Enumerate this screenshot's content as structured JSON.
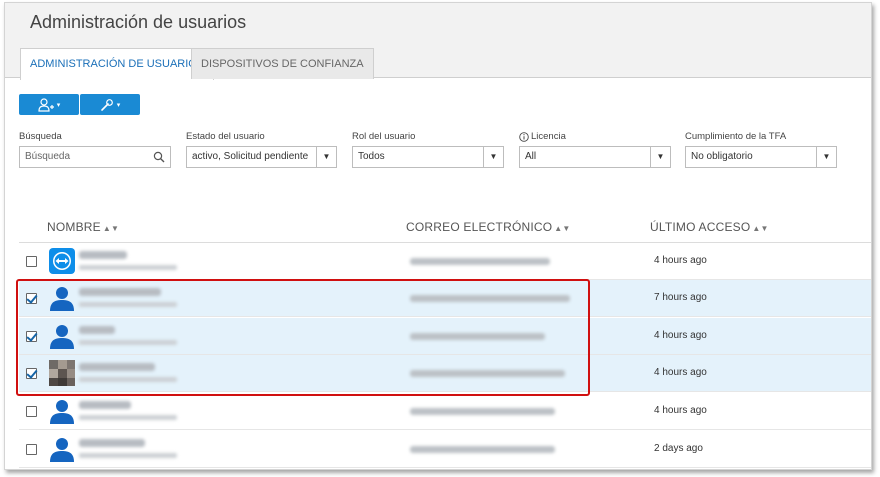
{
  "page": {
    "title": "Administración de usuarios"
  },
  "tabs": [
    {
      "label": "ADMINISTRACIÓN DE USUARIOS",
      "active": true
    },
    {
      "label": "DISPOSITIVOS DE CONFIANZA",
      "active": false
    }
  ],
  "toolbar": {
    "add_user_icon": "user-plus-icon",
    "tools_icon": "wrench-icon",
    "caret": "▾",
    "accent_color": "#1a8ad4"
  },
  "filters": {
    "search": {
      "label": "Búsqueda",
      "placeholder": "Búsqueda"
    },
    "user_state": {
      "label": "Estado del usuario",
      "value": "activo, Solicitud pendiente"
    },
    "user_role": {
      "label": "Rol del usuario",
      "value": "Todos"
    },
    "license": {
      "label": "Licencia",
      "value": "All",
      "info_icon": "info-icon"
    },
    "tfa": {
      "label": "Cumplimiento de la TFA",
      "value": "No obligatorio"
    }
  },
  "table": {
    "columns": [
      {
        "label": "NOMBRE",
        "sort": "▲▼"
      },
      {
        "label": "CORREO ELECTRÓNICO",
        "sort": "▲▼"
      },
      {
        "label": "ÚLTIMO ACCESO",
        "sort": "▲▼"
      }
    ],
    "rows": [
      {
        "selected": false,
        "avatar": "teamviewer-logo-avatar",
        "last_access": "4 hours ago"
      },
      {
        "selected": true,
        "avatar": "default-user-avatar",
        "last_access": "7 hours ago"
      },
      {
        "selected": true,
        "avatar": "default-user-avatar",
        "last_access": "4 hours ago"
      },
      {
        "selected": true,
        "avatar": "photo-avatar",
        "last_access": "4 hours ago"
      },
      {
        "selected": false,
        "avatar": "default-user-avatar",
        "last_access": "4 hours ago"
      },
      {
        "selected": false,
        "avatar": "default-user-avatar",
        "last_access": "2 days ago"
      }
    ]
  },
  "annotation": {
    "highlight_color": "#d01010"
  }
}
